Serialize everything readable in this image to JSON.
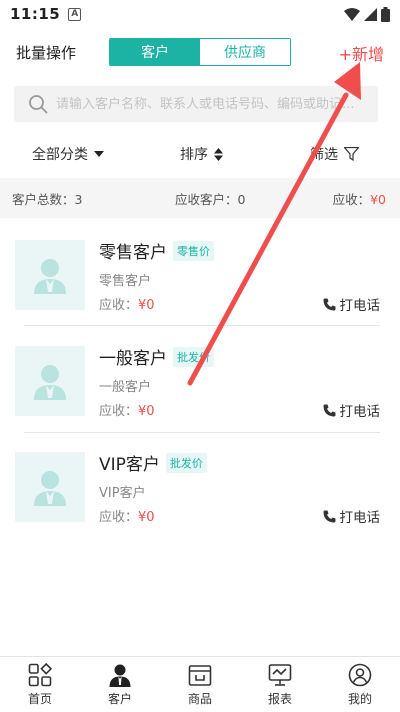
{
  "status": {
    "time": "11:15",
    "notif_badge": "A"
  },
  "header": {
    "batch_label": "批量操作",
    "tabs": [
      {
        "label": "客户",
        "active": true
      },
      {
        "label": "供应商",
        "active": false
      }
    ],
    "add_label": "+新增"
  },
  "search": {
    "placeholder": "请输入客户名称、联系人或电话号码、编码或助记..."
  },
  "filters": {
    "category": "全部分类",
    "sort": "排序",
    "filter": "筛选"
  },
  "summary": {
    "total_label": "客户总数：3",
    "receivable_label": "应收客户：0",
    "due_label": "应收：",
    "due_value": "¥0"
  },
  "customers": [
    {
      "name": "零售客户",
      "tag": "零售价",
      "subtitle": "零售客户",
      "due_label": "应收：",
      "due_value": "¥0",
      "call_label": "打电话"
    },
    {
      "name": "一般客户",
      "tag": "批发价",
      "subtitle": "一般客户",
      "due_label": "应收：",
      "due_value": "¥0",
      "call_label": "打电话"
    },
    {
      "name": "VIP客户",
      "tag": "批发价",
      "subtitle": "VIP客户",
      "due_label": "应收：",
      "due_value": "¥0",
      "call_label": "打电话"
    }
  ],
  "nav": [
    {
      "label": "首页",
      "icon": "home-grid-icon"
    },
    {
      "label": "客户",
      "icon": "customer-icon"
    },
    {
      "label": "商品",
      "icon": "goods-icon"
    },
    {
      "label": "报表",
      "icon": "report-icon"
    },
    {
      "label": "我的",
      "icon": "profile-icon"
    }
  ],
  "colors": {
    "accent": "#1db3a4",
    "red": "#f04d4d"
  }
}
